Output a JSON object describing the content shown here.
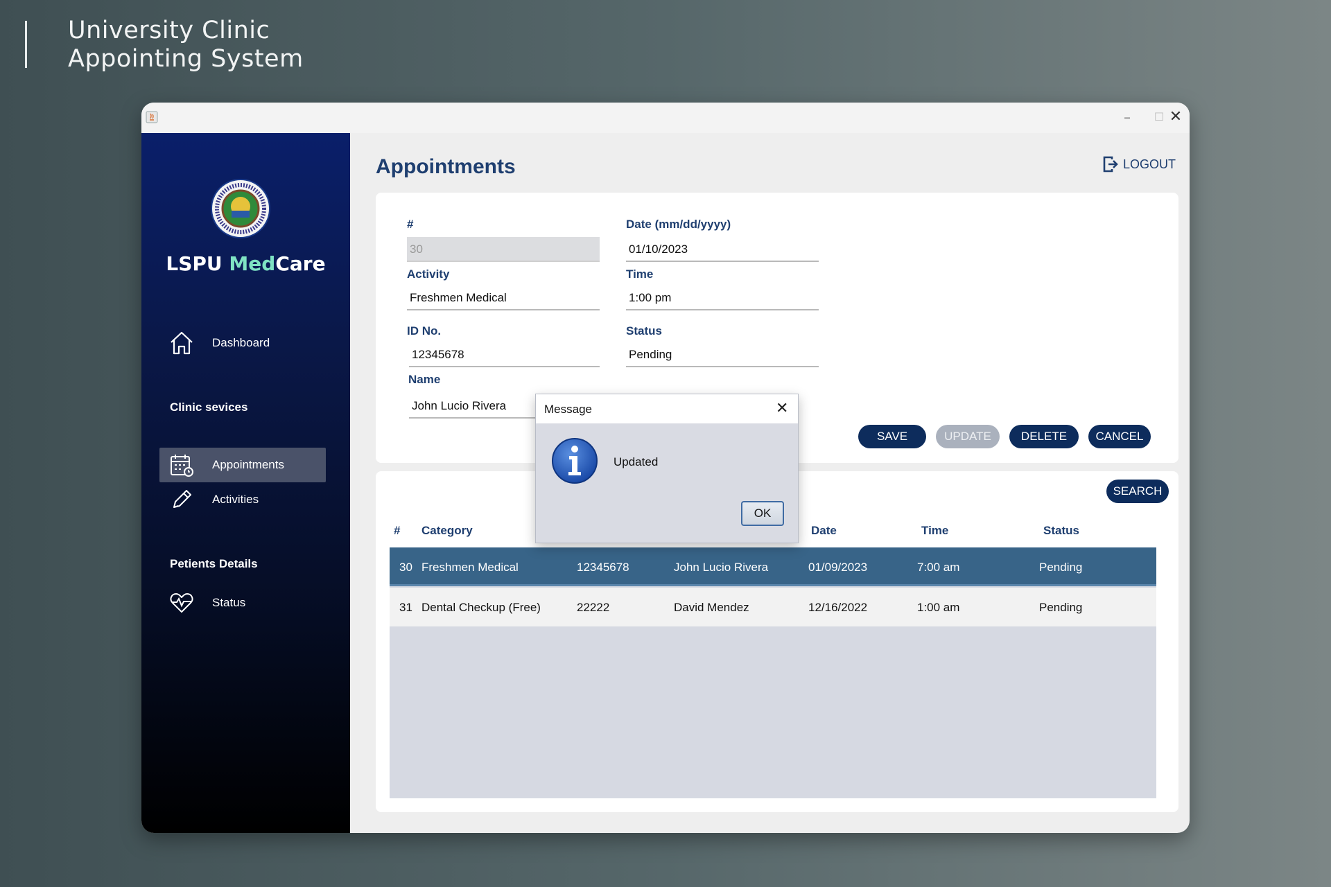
{
  "deck": {
    "title_line1": "University Clinic",
    "title_line2": "Appointing System"
  },
  "window": {
    "minimize_icon": "minimize-icon",
    "maximize_icon": "maximize-icon",
    "close_icon": "close-icon",
    "app_icon": "java-app-icon"
  },
  "sidebar": {
    "brand_part1": "LSPU ",
    "brand_accent": "Med",
    "brand_part2": "Care",
    "brand_accent_color": "#7fe3c3",
    "nav": {
      "dashboard": "Dashboard",
      "clinic_section": "Clinic sevices",
      "appointments": "Appointments",
      "activities": "Activities",
      "patients_section": "Petients Details",
      "status": "Status"
    }
  },
  "main": {
    "title": "Appointments",
    "logout": "LOGOUT"
  },
  "form": {
    "number_label": "#",
    "number_value": "30",
    "date_label": "Date  (mm/dd/yyyy)",
    "date_value": "01/10/2023",
    "activity_label": "Activity",
    "activity_value": "Freshmen Medical",
    "time_label": "Time",
    "time_value": "1:00 pm",
    "id_label": "ID No.",
    "id_value": "12345678",
    "status_label": "Status",
    "status_value": "Pending",
    "name_label": "Name",
    "name_value": "John Lucio Rivera",
    "buttons": {
      "save": "SAVE",
      "update": "UPDATE",
      "delete": "DELETE",
      "cancel": "CANCEL"
    }
  },
  "table": {
    "search": "SEARCH",
    "headers": {
      "num": "#",
      "category": "Category",
      "date": "Date",
      "time": "Time",
      "status": "Status"
    },
    "rows": [
      {
        "num": "30",
        "category": "Freshmen Medical",
        "id": "12345678",
        "name": "John Lucio Rivera",
        "date": "01/09/2023",
        "time": "7:00 am",
        "status": "Pending"
      },
      {
        "num": "31",
        "category": "Dental Checkup (Free)",
        "id": "22222",
        "name": "David Mendez",
        "date": "12/16/2022",
        "time": "1:00 am",
        "status": "Pending"
      }
    ]
  },
  "dialog": {
    "title": "Message",
    "message": "Updated",
    "ok": "OK",
    "icon": "info-icon"
  }
}
